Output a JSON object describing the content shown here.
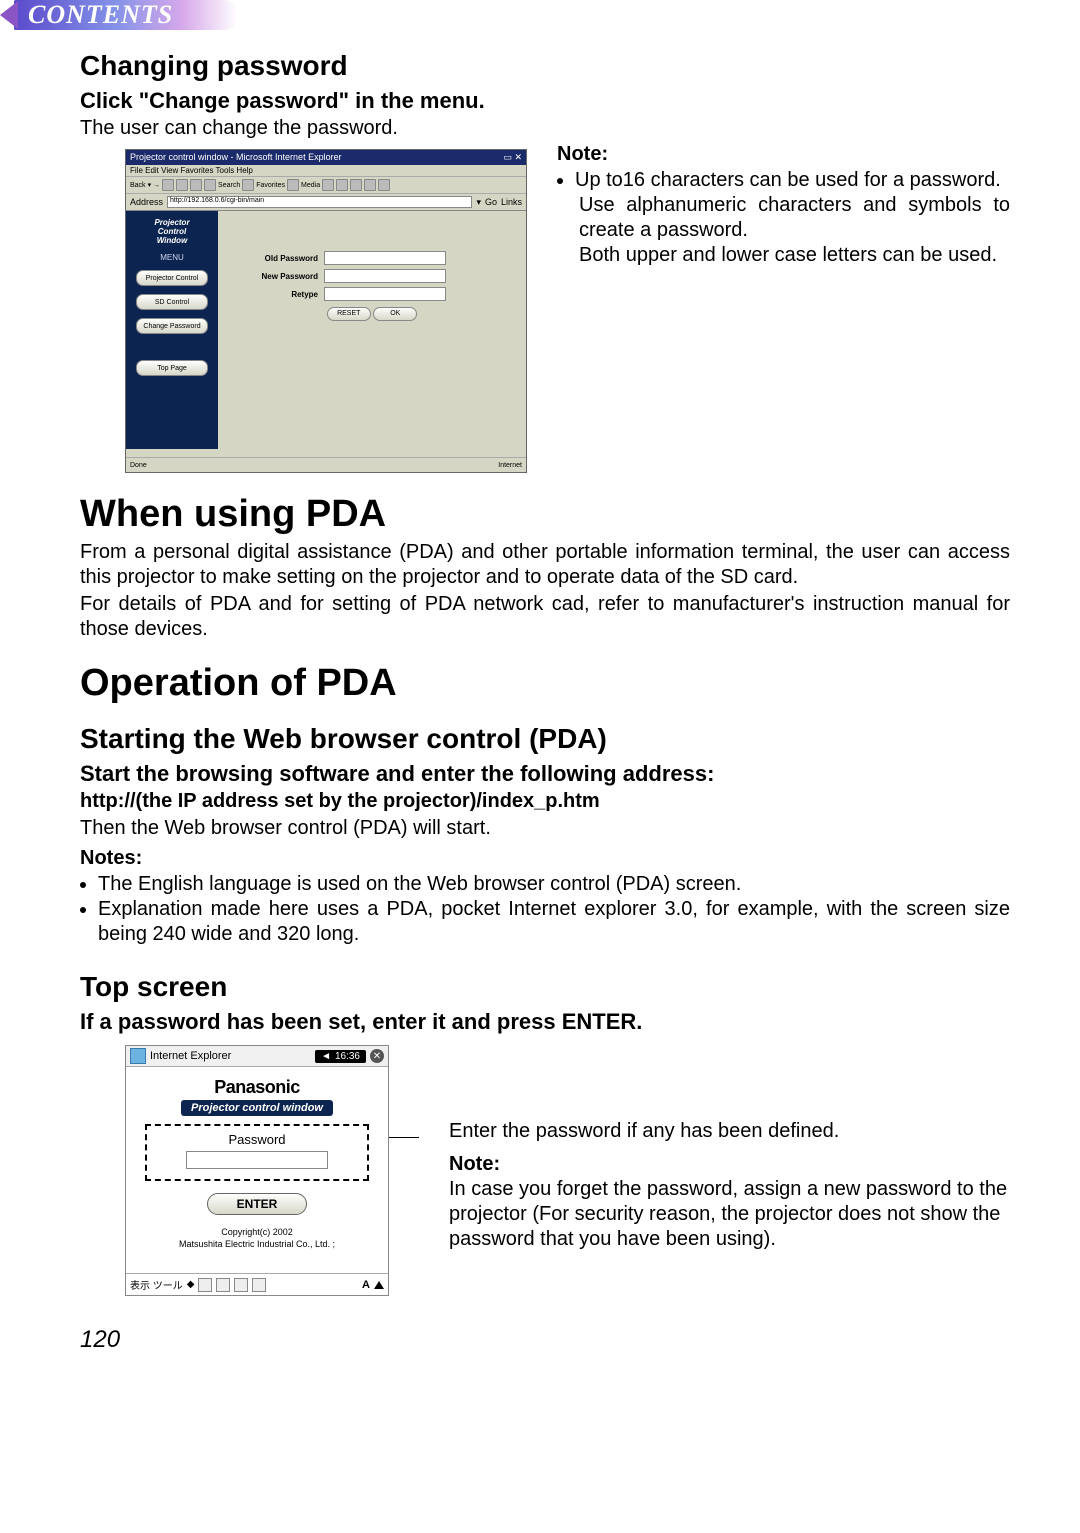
{
  "header": {
    "contents": "CONTENTS"
  },
  "section1": {
    "h2": "Changing password",
    "h3": "Click \"Change password\" in the menu.",
    "body": "The user can change the password."
  },
  "browser": {
    "title": "Projector control window - Microsoft Internet Explorer",
    "menubar": "File  Edit  View  Favorites  Tools  Help",
    "toolbar": [
      "Back",
      "Search",
      "Favorites",
      "Media"
    ],
    "addr_label": "Address",
    "addr_value": "http://192.168.0.6/cgi-bin/main",
    "go": "Go",
    "links": "Links",
    "side_title": "Projector Control Window",
    "side_menu_label": "MENU",
    "side_buttons": [
      "Projector Control",
      "SD Control",
      "Change Password"
    ],
    "side_top": "Top Page",
    "form": {
      "old": "Old Password",
      "new": "New Password",
      "retype": "Retype",
      "reset": "RESET",
      "ok": "OK"
    },
    "status_left": "Done",
    "status_right": "Internet"
  },
  "note1": {
    "title": "Note:",
    "b1": "Up to16 characters can be used for a password.",
    "b1a": "Use alphanumeric characters and symbols to create a password.",
    "b1b": "Both upper and lower case letters can be used."
  },
  "section2": {
    "h1": "When using PDA",
    "p1": "From a personal digital assistance (PDA) and other portable information terminal, the user can access this projector to make setting on the projector and to operate data of the SD card.",
    "p2": "For details of PDA and for setting of PDA network cad, refer to manufacturer's instruction manual for those devices."
  },
  "section3": {
    "h1": "Operation of PDA",
    "h2": "Starting the Web browser control (PDA)",
    "h3": "Start the browsing software and enter the following address:",
    "url": "http://(the IP address set by the projector)/index_p.htm",
    "p": "Then the Web browser control (PDA) will start.",
    "notes_title": "Notes:",
    "note_a": "The English language is used on the Web browser control (PDA) screen.",
    "note_b": "Explanation made here uses a PDA, pocket Internet explorer 3.0, for example, with the screen size being 240 wide and 320 long."
  },
  "section4": {
    "h2": "Top screen",
    "h3": "If a password has been set, enter it and press ENTER."
  },
  "pda": {
    "ie": "Internet Explorer",
    "speaker": "◄",
    "clock": "16:36",
    "close": "✕",
    "brand": "Panasonic",
    "pcw": "Projector control window",
    "pwd_label": "Password",
    "enter": "ENTER",
    "copy1": "Copyright(c) 2002",
    "copy2": "Matsushita Electric Industrial Co., Ltd. ;",
    "footer_left": "表示 ツール",
    "footer_A": "A"
  },
  "callout": {
    "line1": "Enter the password if any has been defined.",
    "note_title": "Note:",
    "note_body": "In case you forget the password, assign a new password to the projector (For security reason, the projector does not show the password that you have been using)."
  },
  "page_num": "120"
}
